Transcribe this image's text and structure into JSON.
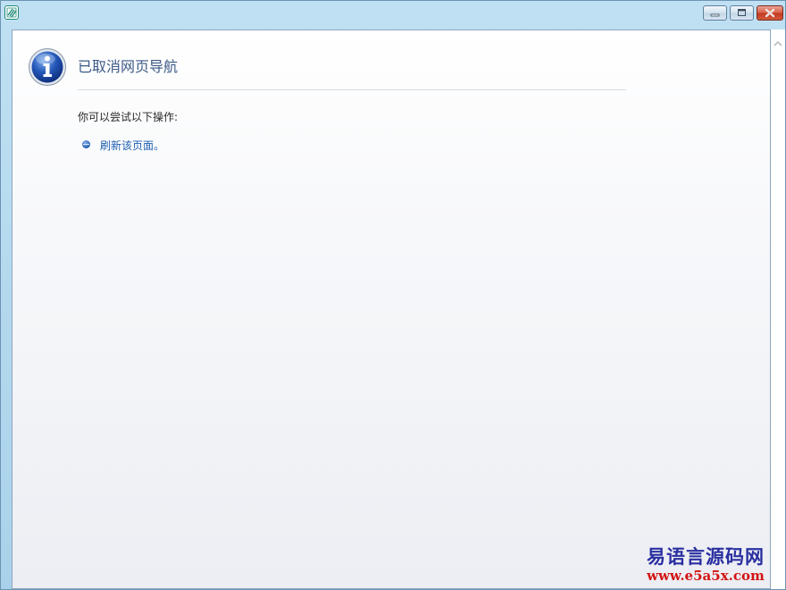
{
  "titlebar": {
    "title": "",
    "app_icon": "easy-language-app-icon",
    "controls": {
      "minimize": "minimize-icon",
      "maximize": "maximize-icon",
      "close": "close-icon"
    }
  },
  "page": {
    "heading": "已取消网页导航",
    "subtitle": "你可以尝试以下操作:",
    "actions": [
      {
        "label": "刷新该页面。"
      }
    ]
  },
  "watermark": {
    "name": "易语言源码网",
    "url": "www.e5a5x.com"
  },
  "colors": {
    "heading": "#3c5a86",
    "link": "#1f5fb0",
    "watermark_name": "#2a2fa0",
    "watermark_url": "#d21414"
  }
}
